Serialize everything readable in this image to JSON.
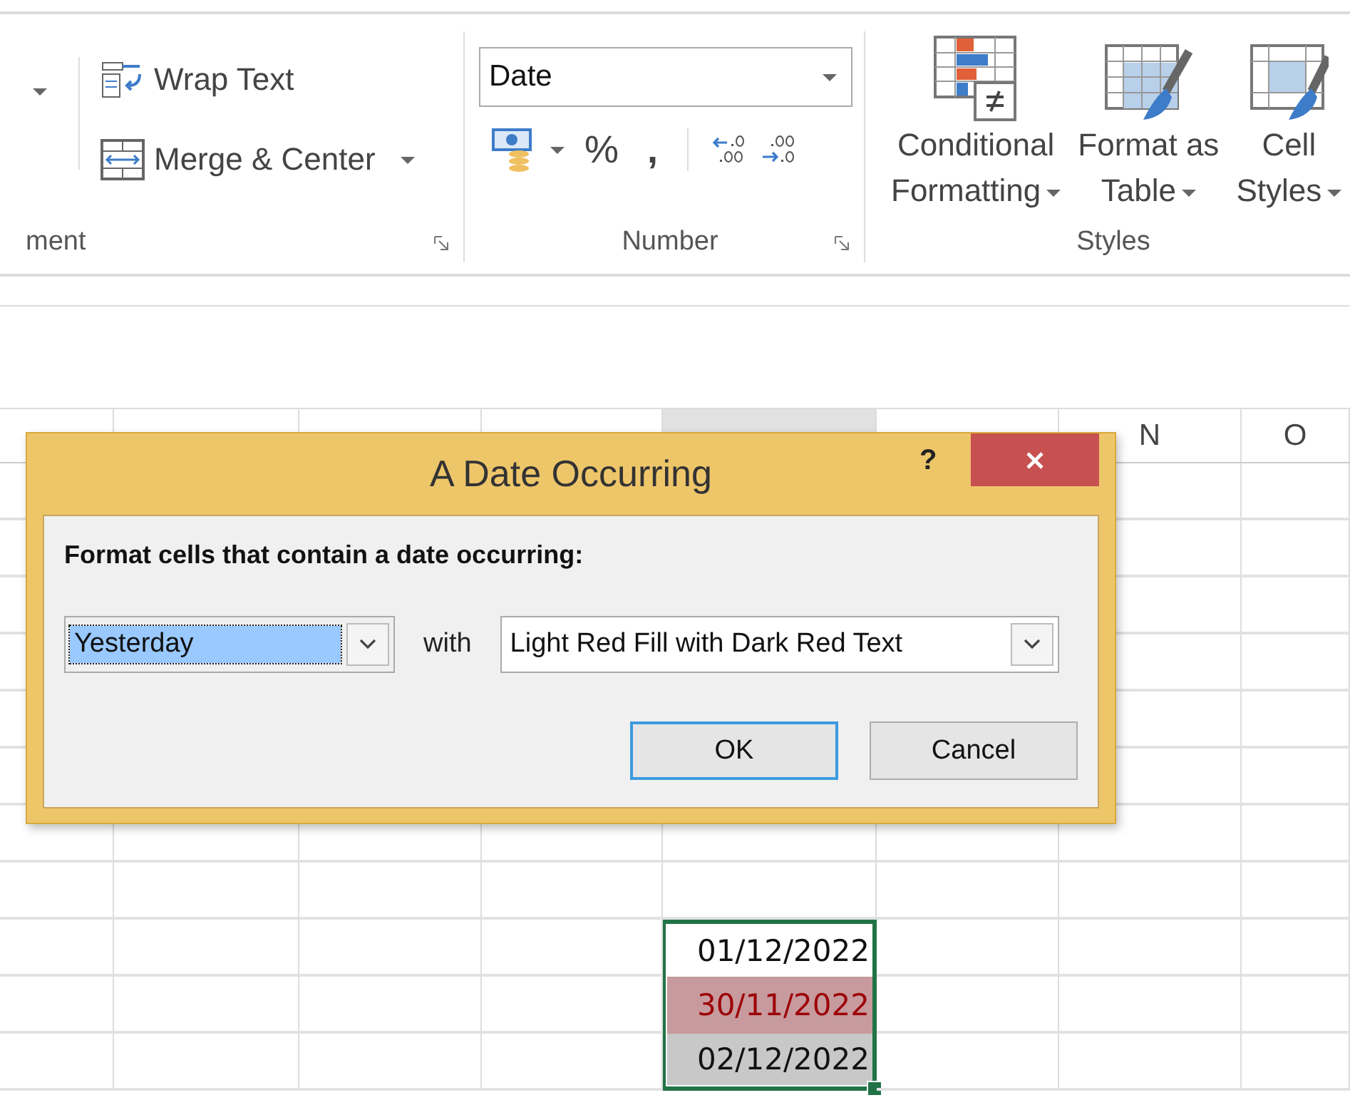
{
  "ribbon": {
    "alignment_group": {
      "label": "ment",
      "wrap_text": "Wrap Text",
      "merge_center": "Merge & Center"
    },
    "number_group": {
      "label": "Number",
      "format_dropdown": {
        "value": "Date"
      },
      "percent": "%",
      "comma": ","
    },
    "styles_group": {
      "label": "Styles",
      "buttons": [
        {
          "line1": "Conditional",
          "line2": "Formatting",
          "kind": "conditional"
        },
        {
          "line1": "Format as",
          "line2": "Table",
          "kind": "table"
        },
        {
          "line1": "Cell",
          "line2": "Styles",
          "kind": "cell"
        }
      ]
    }
  },
  "grid": {
    "columns": [
      {
        "selected": false
      },
      {
        "selected": false
      },
      {
        "selected": false
      },
      {
        "selected": false
      },
      {
        "selected": true
      },
      {
        "selected": false
      },
      {
        "label": "N",
        "selected": false
      },
      {
        "label": "O",
        "selected": false
      }
    ],
    "selected_range": [
      {
        "value": "01/12/2022",
        "color": "#ffffff",
        "conditional": false
      },
      {
        "value": "30/11/2022",
        "color": "#c79a9d",
        "conditional": true
      },
      {
        "value": "02/12/2022",
        "color": "#c8c8c8",
        "conditional": false
      }
    ]
  },
  "dialog": {
    "title": "A Date Occurring",
    "help": "?",
    "prompt": "Format cells that contain a date occurring:",
    "period": {
      "value": "Yesterday",
      "focused": true
    },
    "connector": "with",
    "format": {
      "value": "Light Red Fill with Dark Red Text"
    },
    "buttons": [
      {
        "label": "OK",
        "default": true
      },
      {
        "label": "Cancel",
        "default": false
      }
    ]
  }
}
